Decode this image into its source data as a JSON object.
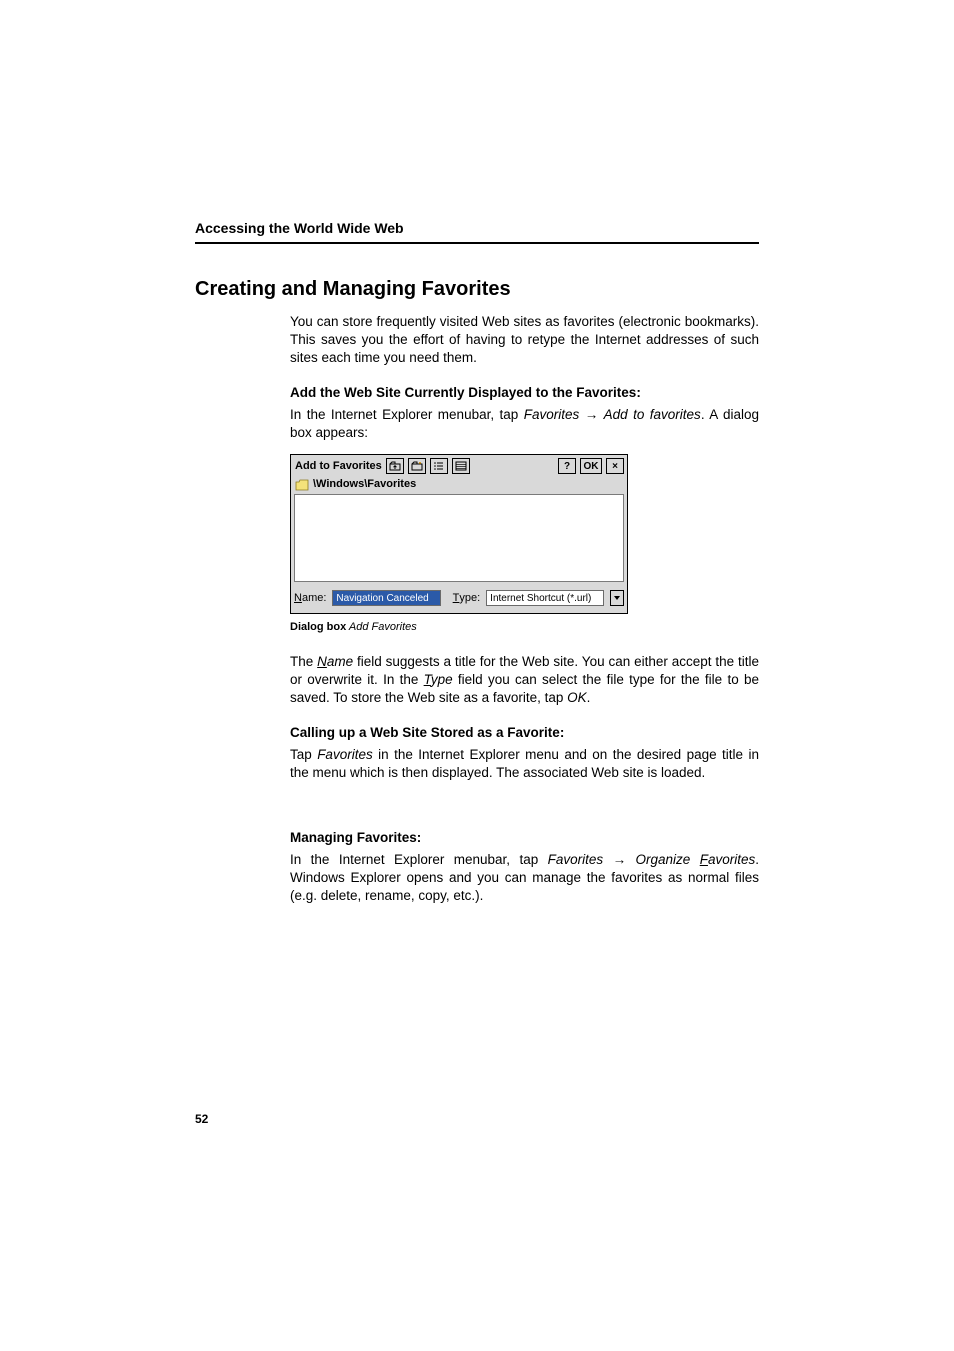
{
  "runningHead": "Accessing the World Wide Web",
  "heading1": "Creating and Managing Favorites",
  "introPara": "You can store frequently visited Web sites as favorites (electronic bookmarks). This saves you the effort of having to retype the Internet addresses of such sites each time you need them.",
  "sub1": "Add the Web Site Currently Displayed to the Favorites:",
  "p1a_pre": "In the Internet Explorer menubar, tap ",
  "p1a_fav": "Favorites",
  "p1a_arrow": " → ",
  "p1a_add": "Add to favorites",
  "p1a_post": ". A dialog box appears:",
  "dialog": {
    "title": "Add to Favorites",
    "help": "?",
    "ok": "OK",
    "close": "×",
    "path": "\\Windows\\Favorites",
    "nameLabelFirst": "N",
    "nameLabelRest": "ame:",
    "nameValue": "Navigation Canceled",
    "typeLabelFirst": "T",
    "typeLabelRest": "ype:",
    "typeValue": "Internet Shortcut (*.url)"
  },
  "captionBold": "Dialog box",
  "captionItalic": " Add Favorites",
  "p2_pre": "The ",
  "p2_NameFirst": "N",
  "p2_NameRest": "ame",
  "p2_mid1": " field suggests a title for the Web site. You can either accept the title or overwrite it. In the ",
  "p2_TypeFirst": "T",
  "p2_TypeRest": "ype",
  "p2_mid2": " field you can select the file type for the file to be saved. To store the Web site as a favorite, tap ",
  "p2_ok": "OK",
  "p2_end": ".",
  "sub2": "Calling up a Web Site Stored as a Favorite:",
  "p3_pre": "Tap ",
  "p3_fav": "Favorites",
  "p3_post": " in the Internet Explorer menu and on the desired page title in the menu which is then displayed. The associated Web site is loaded.",
  "sub3": "Managing Favorites:",
  "p4_pre": "In the Internet Explorer menubar, tap ",
  "p4_fav": "Favorites",
  "p4_arrow": "  → ",
  "p4_orgFirst": "F",
  "p4_orgPre": "Organize ",
  "p4_orgRest": "avorites",
  "p4_post": ". Windows Explorer opens and you can manage the favorites as normal files (e.g. delete, rename, copy, etc.).",
  "pageNumber": "52"
}
